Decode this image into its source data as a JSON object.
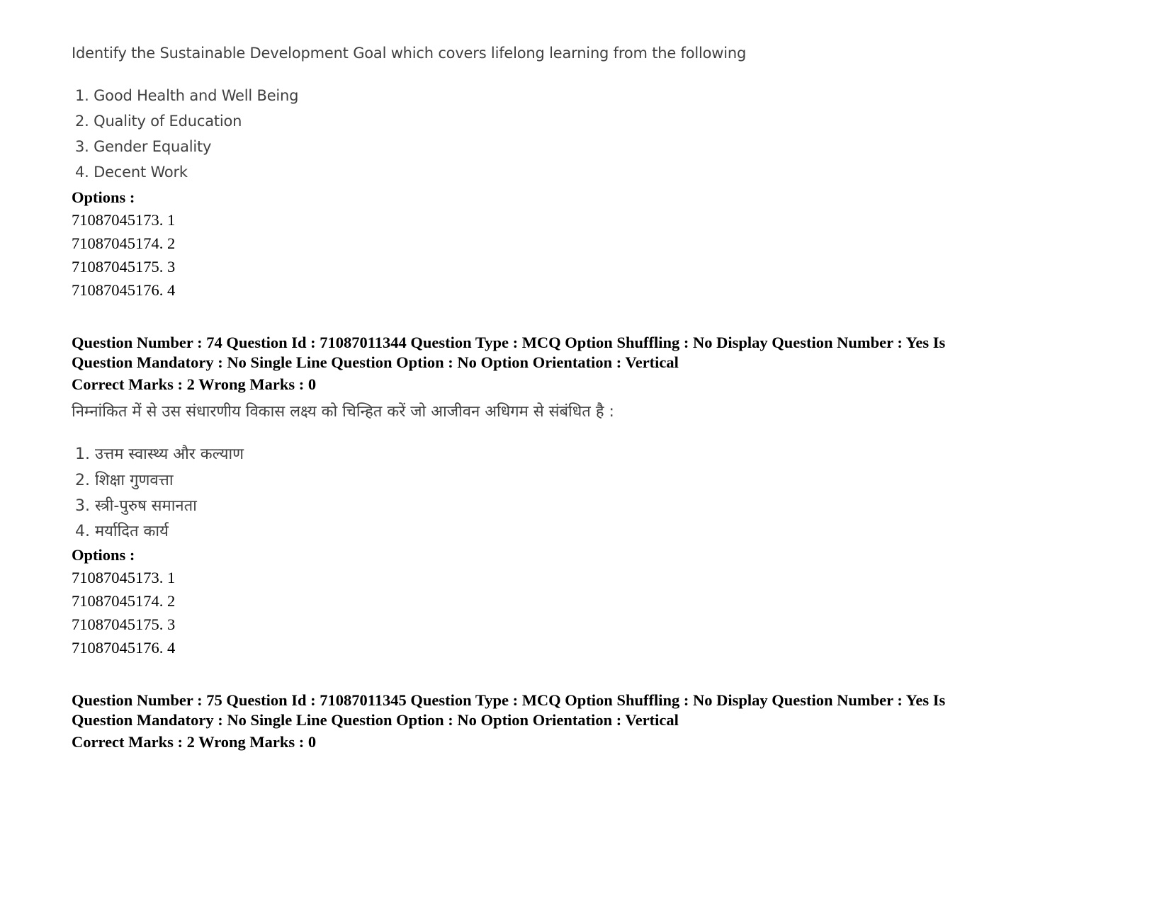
{
  "question_prev": {
    "text_en": "Identify the Sustainable Development Goal which covers lifelong learning from the following",
    "items_en": [
      "1. Good Health and Well Being",
      "2. Quality of Education",
      "3. Gender Equality",
      "4. Decent Work"
    ],
    "options_label": "Options :",
    "options": [
      "71087045173. 1",
      "71087045174. 2",
      "71087045175. 3",
      "71087045176. 4"
    ]
  },
  "question_74": {
    "meta_line1": "Question Number : 74 Question Id : 71087011344 Question Type : MCQ Option Shuffling : No Display Question Number : Yes Is",
    "meta_line2": "Question Mandatory : No Single Line Question Option : No Option Orientation : Vertical",
    "marks": "Correct Marks : 2 Wrong Marks : 0",
    "text_hi": "निम्नांकित में से उस संधारणीय विकास लक्ष्य को चिन्हित करें जो आजीवन अधिगम से संबंधित है :",
    "items_hi": [
      "1. उत्तम स्वास्थ्य और कल्याण",
      "2. शिक्षा गुणवत्ता",
      "3. स्त्री-पुरुष समानता",
      "4. मर्यादित कार्य"
    ],
    "options_label": "Options :",
    "options": [
      "71087045173. 1",
      "71087045174. 2",
      "71087045175. 3",
      "71087045176. 4"
    ]
  },
  "question_75": {
    "meta_line1": "Question Number : 75 Question Id : 71087011345 Question Type : MCQ Option Shuffling : No Display Question Number : Yes Is",
    "meta_line2": "Question Mandatory : No Single Line Question Option : No Option Orientation : Vertical",
    "marks": "Correct Marks : 2 Wrong Marks : 0"
  }
}
